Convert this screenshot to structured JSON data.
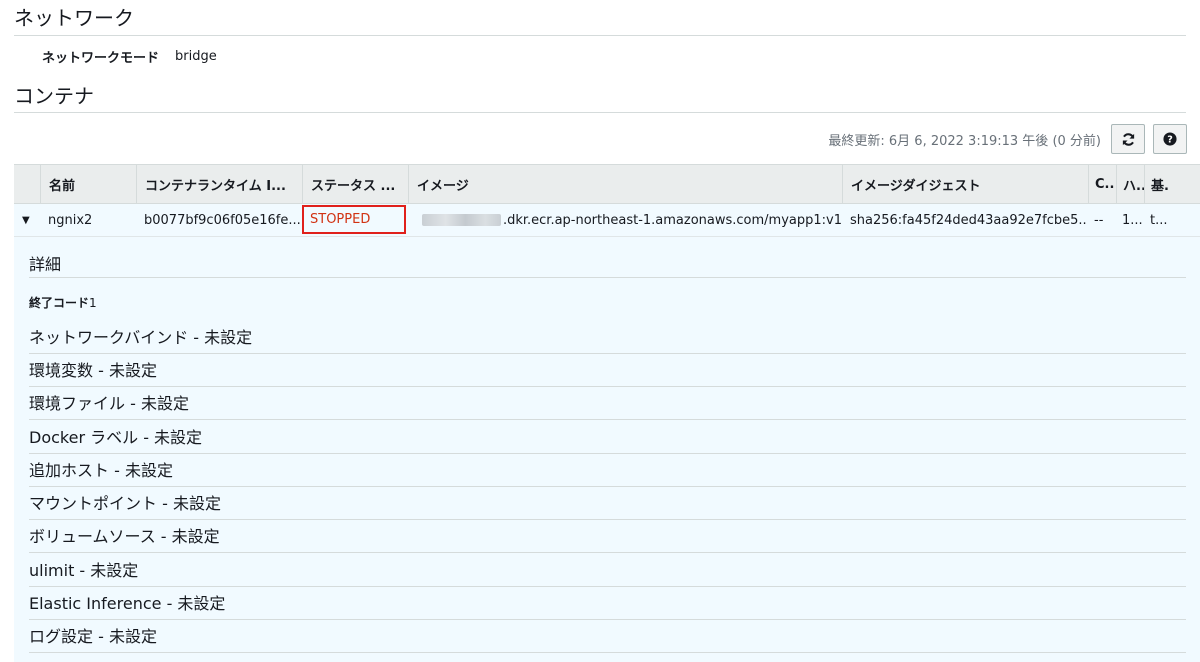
{
  "network": {
    "title": "ネットワーク",
    "mode_label": "ネットワークモード",
    "mode_value": "bridge"
  },
  "containers": {
    "title": "コンテナ",
    "last_updated": "最終更新: 6月 6, 2022 3:19:13 午後 (0 分前)",
    "refresh_icon": "refresh-icon",
    "help_icon": "help-icon",
    "columns": [
      "名前",
      "コンテナランタイム I...",
      "ステータス ...",
      "イメージ",
      "イメージダイジェスト",
      "C..",
      "ハ..",
      "基."
    ],
    "row": {
      "name": "ngnix2",
      "runtime_id": "b0077bf9c06f05e16fe...",
      "status": "STOPPED",
      "image": ".dkr.ecr.ap-northeast-1.amazonaws.com/myapp1:v1",
      "image_digest": "sha256:fa45f24ded43aa92e7fcbe5...",
      "c": "--",
      "h": "1...",
      "k": "t...",
      "status_color": "#d13212"
    }
  },
  "details": {
    "heading": "詳細",
    "exit_code_label": "終了コード",
    "exit_code_value": "1",
    "items": [
      "ネットワークバインド - 未設定",
      "環境変数 - 未設定",
      "環境ファイル - 未設定",
      "Docker ラベル - 未設定",
      "追加ホスト - 未設定",
      "マウントポイント - 未設定",
      "ボリュームソース - 未設定",
      "ulimit - 未設定",
      "Elastic Inference - 未設定",
      "ログ設定 - 未設定"
    ]
  }
}
